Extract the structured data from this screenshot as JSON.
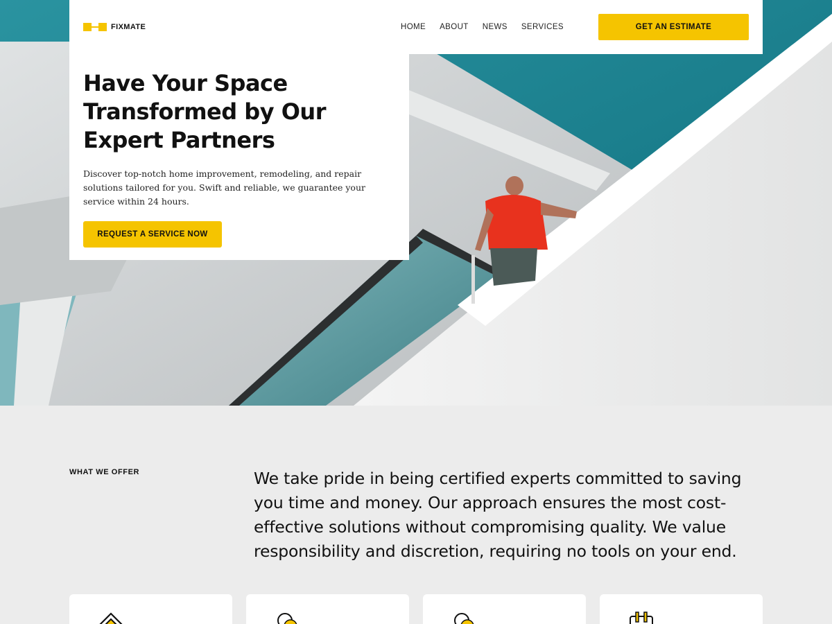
{
  "brand": {
    "name": "FIXMATE",
    "accent": "#f5c400"
  },
  "nav": {
    "items": [
      "HOME",
      "ABOUT",
      "NEWS",
      "SERVICES"
    ],
    "cta_label": "GET AN ESTIMATE"
  },
  "hero": {
    "title": "Have Your Space Transformed by Our Expert Partners",
    "description": "Discover top-notch home improvement, remodeling, and repair solutions tailored for you. Swift and reliable, we guarantee your service within 24 hours.",
    "cta_label": "REQUEST A SERVICE NOW",
    "image": "worker-on-staircase-photo"
  },
  "offer": {
    "label": "WHAT WE OFFER",
    "text": "We take pride in being certified experts committed to saving you time and money. Our approach ensures the most cost-effective solutions without compromising quality. We value responsibility and discretion, requiring no tools on your end."
  },
  "services": [
    {
      "icon": "house-icon"
    },
    {
      "icon": "bulb-icon"
    },
    {
      "icon": "bulb-icon"
    },
    {
      "icon": "plug-icon"
    }
  ]
}
